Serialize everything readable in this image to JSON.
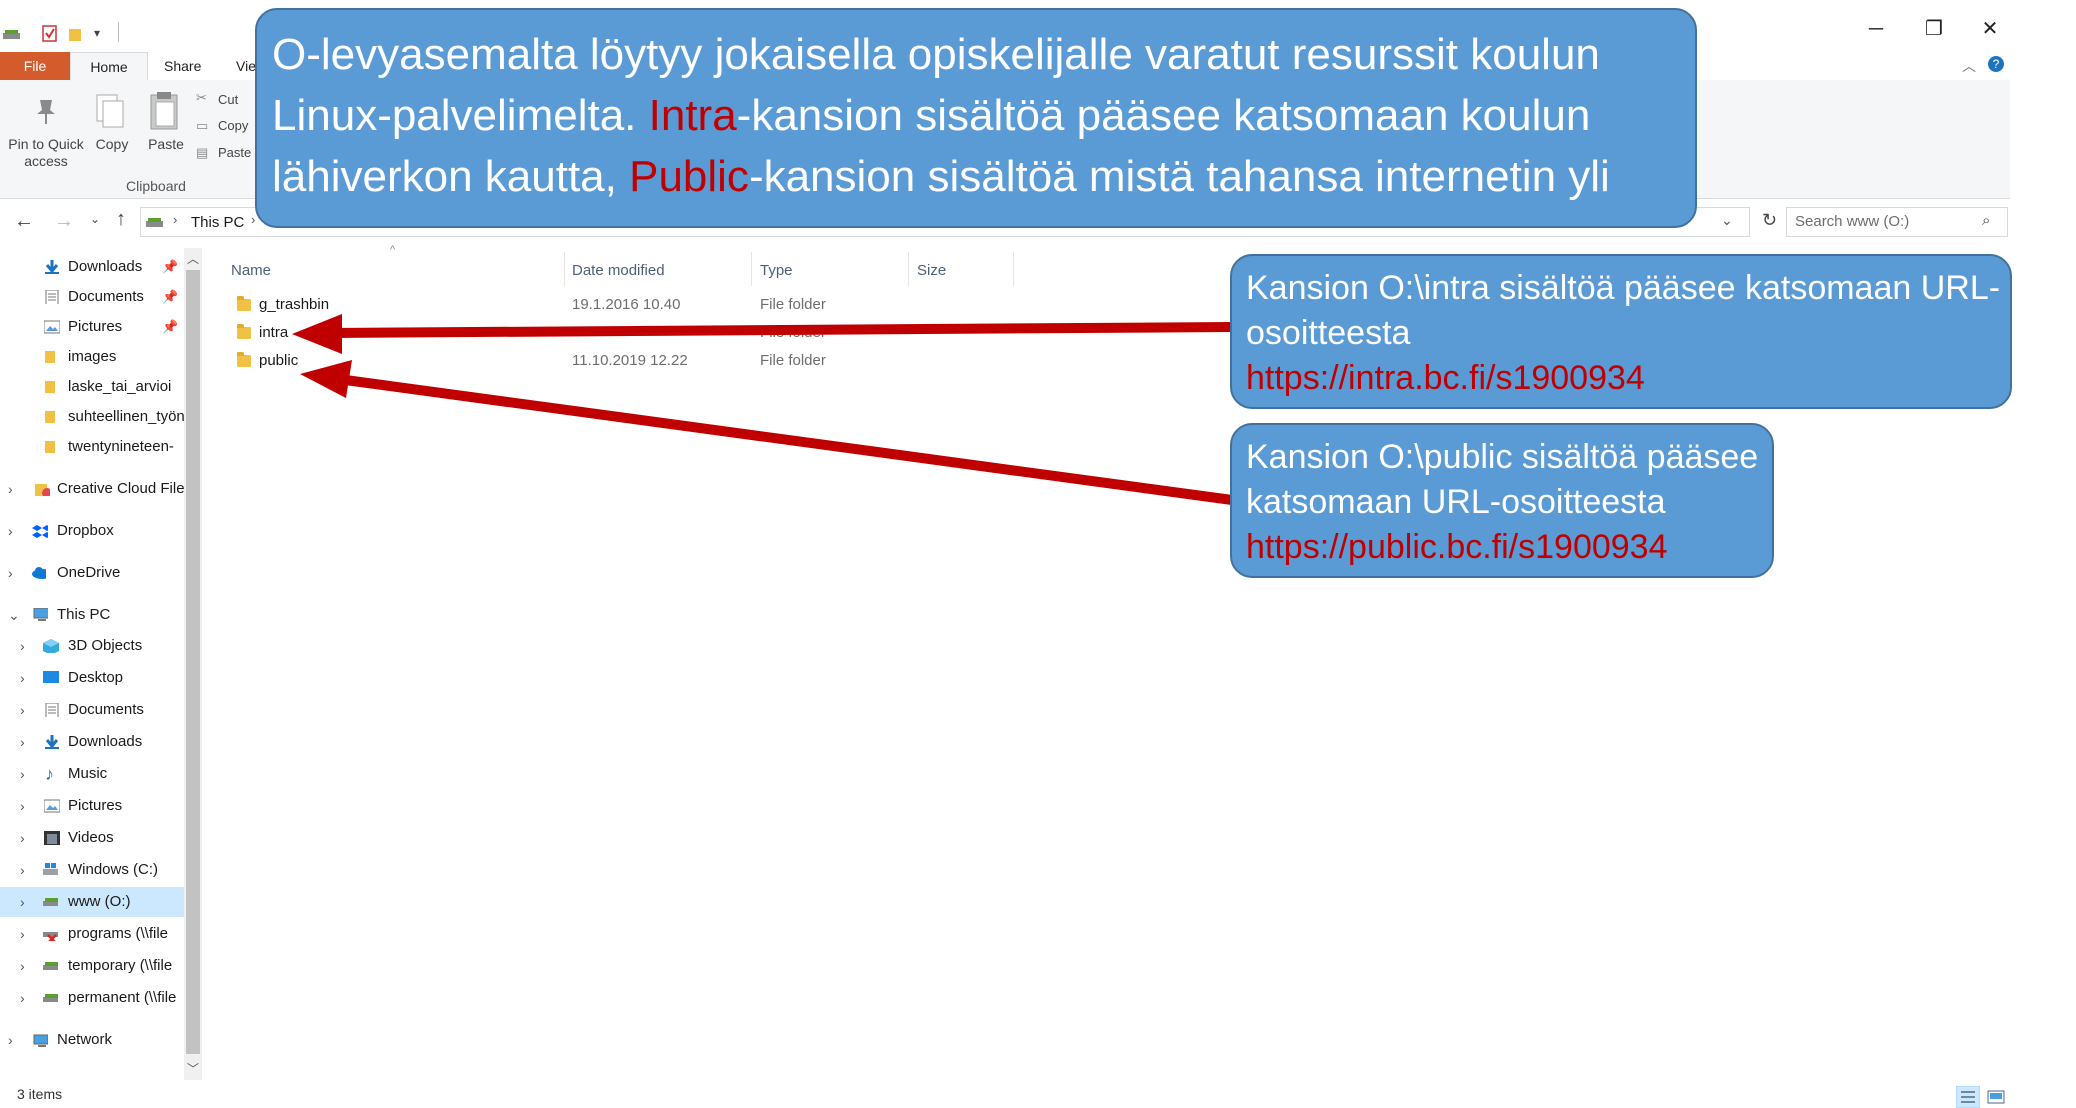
{
  "window": {
    "qat_icons": [
      "drive-icon",
      "checkbox-icon",
      "folder-icon",
      "dropdown-icon"
    ],
    "controls": {
      "minimize": "─",
      "maximize": "❐",
      "close": "✕"
    }
  },
  "ribbon": {
    "tabs": [
      "File",
      "Home",
      "Share",
      "Vie"
    ],
    "pin_label_1": "Pin to Quick",
    "pin_label_2": "access",
    "copy_label": "Copy",
    "paste_label": "Paste",
    "cut_label": "Cut",
    "copy_path_label": "Copy",
    "paste_shortcut_label": "Paste",
    "group_clipboard": "Clipboard"
  },
  "address": {
    "path": "This PC",
    "search_placeholder": "Search www (O:)"
  },
  "nav": {
    "quick": [
      {
        "label": "Downloads",
        "pinned": true,
        "icon": "download-arrow-icon"
      },
      {
        "label": "Documents",
        "pinned": true,
        "icon": "documents-icon"
      },
      {
        "label": "Pictures",
        "pinned": true,
        "icon": "pictures-icon"
      },
      {
        "label": "images",
        "icon": "folder-icon"
      },
      {
        "label": "laske_tai_arvioi",
        "icon": "folder-icon"
      },
      {
        "label": "suhteellinen_työn",
        "icon": "folder-icon"
      },
      {
        "label": "twentynineteen-",
        "icon": "folder-icon"
      }
    ],
    "creative_cloud": "Creative Cloud File",
    "dropbox": "Dropbox",
    "onedrive": "OneDrive",
    "this_pc": "This PC",
    "pc_items": [
      {
        "label": "3D Objects",
        "icon": "cube-icon"
      },
      {
        "label": "Desktop",
        "icon": "desktop-icon"
      },
      {
        "label": "Documents",
        "icon": "documents-icon"
      },
      {
        "label": "Downloads",
        "icon": "download-arrow-icon"
      },
      {
        "label": "Music",
        "icon": "music-icon"
      },
      {
        "label": "Pictures",
        "icon": "pictures-icon"
      },
      {
        "label": "Videos",
        "icon": "film-icon"
      },
      {
        "label": "Windows (C:)",
        "icon": "windows-drive-icon"
      },
      {
        "label": "www (O:)",
        "icon": "network-drive-icon",
        "selected": true
      },
      {
        "label": "programs (\\\\file",
        "icon": "network-drive-disconnected-icon"
      },
      {
        "label": "temporary (\\\\file",
        "icon": "network-drive-icon"
      },
      {
        "label": "permanent (\\\\file",
        "icon": "network-drive-icon"
      }
    ],
    "network": "Network"
  },
  "columns": {
    "name": "Name",
    "date": "Date modified",
    "type": "Type",
    "size": "Size"
  },
  "files": [
    {
      "name": "g_trashbin",
      "date": "19.1.2016 10.40",
      "type": "File folder"
    },
    {
      "name": "intra",
      "date": "",
      "type": "File folder"
    },
    {
      "name": "public",
      "date": "11.10.2019 12.22",
      "type": "File folder"
    }
  ],
  "status": {
    "items": "3 items"
  },
  "callouts": {
    "main": {
      "line1": "O-levyasemalta löytyy jokaisella opiskelijalle varatut resurssit koulun",
      "line2_pre": "Linux-palvelimelta. ",
      "line2_red": "Intra",
      "line2_post": "-kansion sisältöä pääsee katsomaan koulun",
      "line3_pre": "lähiverkon kautta, ",
      "line3_red": "Public",
      "line3_post": "-kansion sisältöä mistä tahansa internetin yli"
    },
    "intra": {
      "line1": "Kansion O:\\intra sisältöä pääsee katsomaan URL-",
      "line2": "osoitteesta",
      "url": "https://intra.bc.fi/s1900934"
    },
    "public": {
      "line1": "Kansion O:\\public sisältöä pääsee",
      "line2": "katsomaan URL-osoitteesta",
      "url": "https://public.bc.fi/s1900934"
    }
  },
  "colors": {
    "accent_red": "#c00000",
    "callout_fill": "#5b9bd5",
    "callout_border": "#41719c",
    "arrow": "#c00000",
    "file_tab": "#d35b2c"
  }
}
